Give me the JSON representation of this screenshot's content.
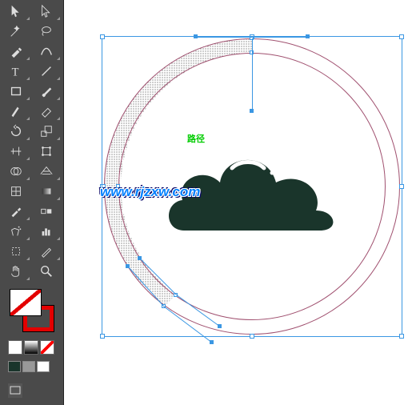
{
  "toolbar": {
    "tools": [
      {
        "name": "selection-tool",
        "icon": "sel"
      },
      {
        "name": "direct-selection-tool",
        "icon": "dsel"
      },
      {
        "name": "magic-wand-tool",
        "icon": "wand"
      },
      {
        "name": "lasso-tool",
        "icon": "lasso"
      },
      {
        "name": "pen-tool",
        "icon": "pen"
      },
      {
        "name": "curvature-tool",
        "icon": "curv"
      },
      {
        "name": "type-tool",
        "icon": "type"
      },
      {
        "name": "line-segment-tool",
        "icon": "line"
      },
      {
        "name": "rectangle-tool",
        "icon": "rect"
      },
      {
        "name": "paintbrush-tool",
        "icon": "brush"
      },
      {
        "name": "shaper-tool",
        "icon": "shaper"
      },
      {
        "name": "eraser-tool",
        "icon": "eraser"
      },
      {
        "name": "rotate-tool",
        "icon": "rotate"
      },
      {
        "name": "scale-tool",
        "icon": "scale"
      },
      {
        "name": "width-tool",
        "icon": "width"
      },
      {
        "name": "free-transform-tool",
        "icon": "ftrans"
      },
      {
        "name": "shape-builder-tool",
        "icon": "sbuild"
      },
      {
        "name": "perspective-grid-tool",
        "icon": "persp"
      },
      {
        "name": "mesh-tool",
        "icon": "mesh"
      },
      {
        "name": "gradient-tool",
        "icon": "grad"
      },
      {
        "name": "eyedropper-tool",
        "icon": "eye"
      },
      {
        "name": "blend-tool",
        "icon": "blend"
      },
      {
        "name": "symbol-sprayer-tool",
        "icon": "spray"
      },
      {
        "name": "column-graph-tool",
        "icon": "graph"
      },
      {
        "name": "artboard-tool",
        "icon": "artb"
      },
      {
        "name": "slice-tool",
        "icon": "slice"
      },
      {
        "name": "hand-tool",
        "icon": "hand"
      },
      {
        "name": "zoom-tool",
        "icon": "zoom"
      }
    ]
  },
  "colors": {
    "fill": "none",
    "stroke": "#e30000",
    "swatches": [
      "#1a352b",
      "#999999",
      "#ffffff"
    ]
  },
  "canvas": {
    "green_label": "路径",
    "watermark": "www.rjzxw.com",
    "cloud_color": "#1a352b",
    "ring_stroke": "#a0506f",
    "selection_color": "#3b97e3"
  }
}
